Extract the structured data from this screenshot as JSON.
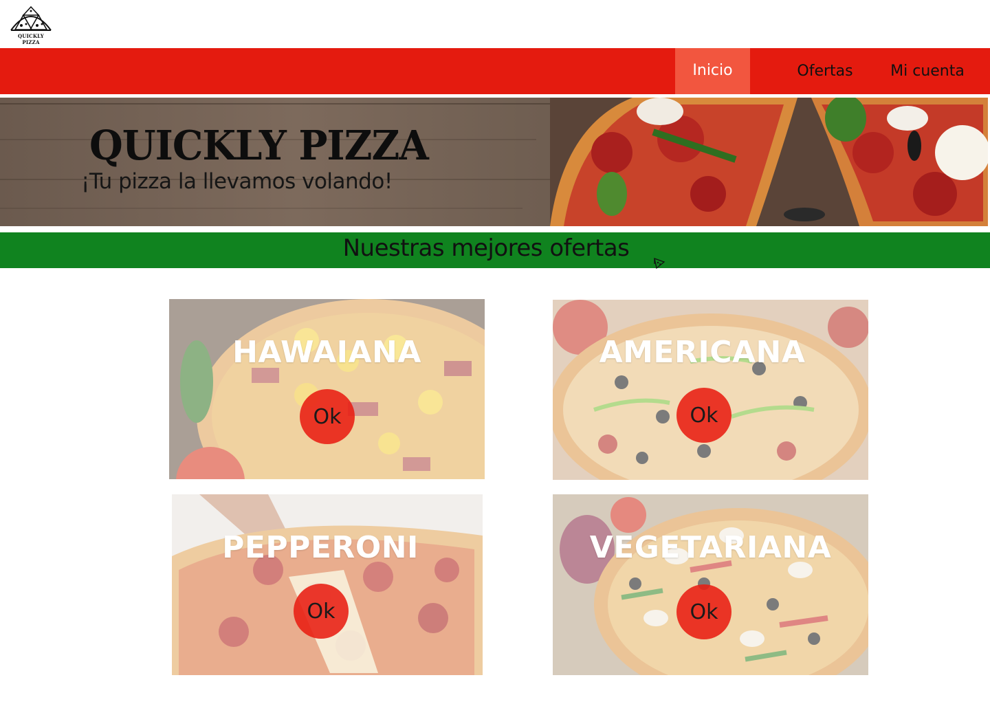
{
  "brand": {
    "logo_text": "QUICKLY PIZZA",
    "logo_icon": "pizza-slices-logo-icon"
  },
  "nav": {
    "items": [
      {
        "label": "Inicio",
        "active": true
      },
      {
        "label": "Ofertas",
        "active": false
      },
      {
        "label": "Mi cuenta",
        "active": false
      }
    ]
  },
  "hero": {
    "title": "QUICKLY PIZZA",
    "subtitle": "¡Tu pizza la llevamos volando!"
  },
  "offers": {
    "heading": "Nuestras mejores ofertas",
    "icon": "pizza-slice-icon"
  },
  "products": [
    {
      "name": "HAWAIANA",
      "button_label": "Ok"
    },
    {
      "name": "AMERICANA",
      "button_label": "Ok"
    },
    {
      "name": "PEPPERONI",
      "button_label": "Ok"
    },
    {
      "name": "VEGETARIANA",
      "button_label": "Ok"
    }
  ],
  "colors": {
    "nav_bg": "#e41b0f",
    "nav_active_bg": "#f2563f",
    "offers_bar_bg": "#10831f",
    "ok_button_bg": "#e81e12"
  }
}
